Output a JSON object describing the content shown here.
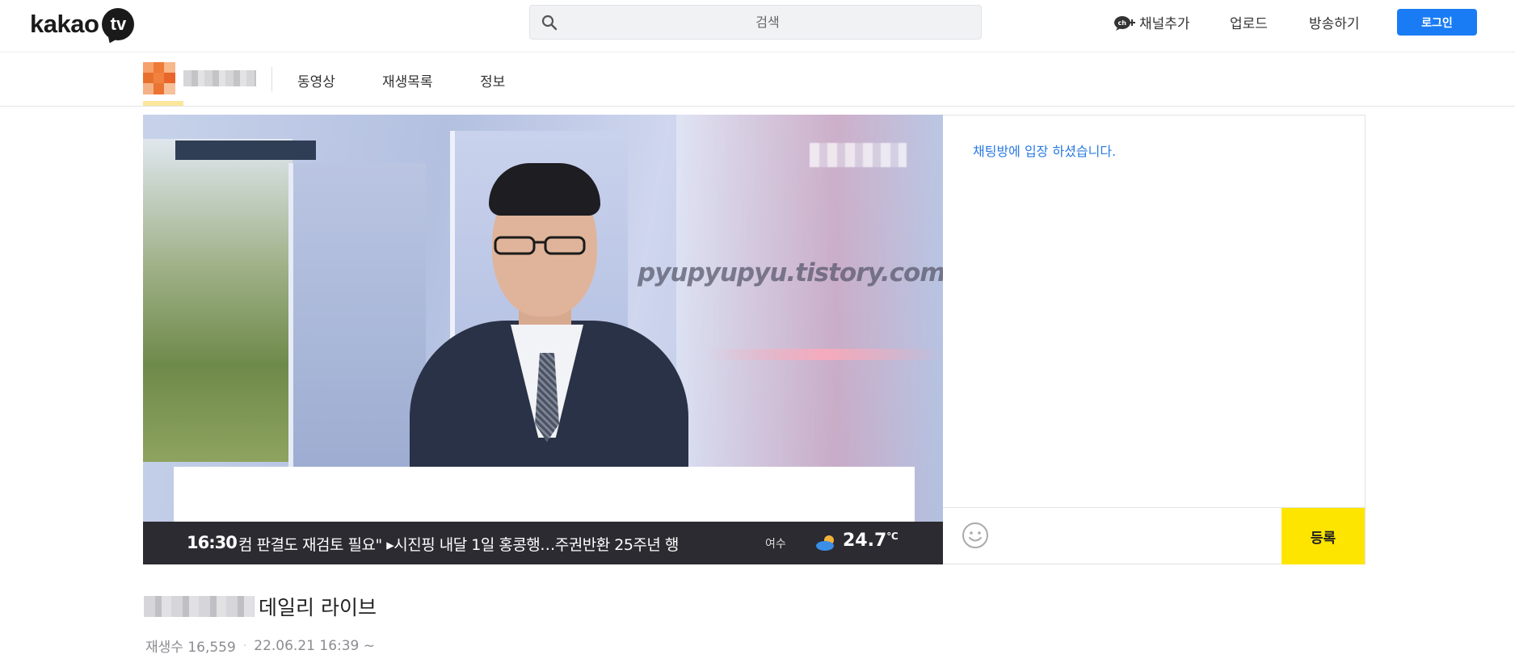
{
  "header": {
    "logo_text": "kakao",
    "logo_badge": "tv",
    "search_placeholder": "검색",
    "channel_add_label": "채널추가",
    "upload_label": "업로드",
    "broadcast_label": "방송하기",
    "login_label": "로그인",
    "accent_color": "#1a7cf5"
  },
  "channel": {
    "name": "",
    "tabs": [
      "동영상",
      "재생목록",
      "정보"
    ]
  },
  "player": {
    "watermark": "pyupyupyu.tistory.com",
    "ticker_time": "16:30",
    "ticker_news": "컴 판결도 재검토 필요\"    ▸시진핑 내달 1일 홍콩행…주권반환 25주년 행",
    "ticker_city": "여수",
    "ticker_temp": "24.7",
    "ticker_unit": "℃"
  },
  "chat": {
    "system_message": "채팅방에 입장 하셨습니다.",
    "input_value": "",
    "submit_label": "등록",
    "submit_color": "#fee500"
  },
  "video": {
    "title": "데일리 라이브",
    "views": "재생수 16,559",
    "date": "22.06.21 16:39 ~"
  }
}
